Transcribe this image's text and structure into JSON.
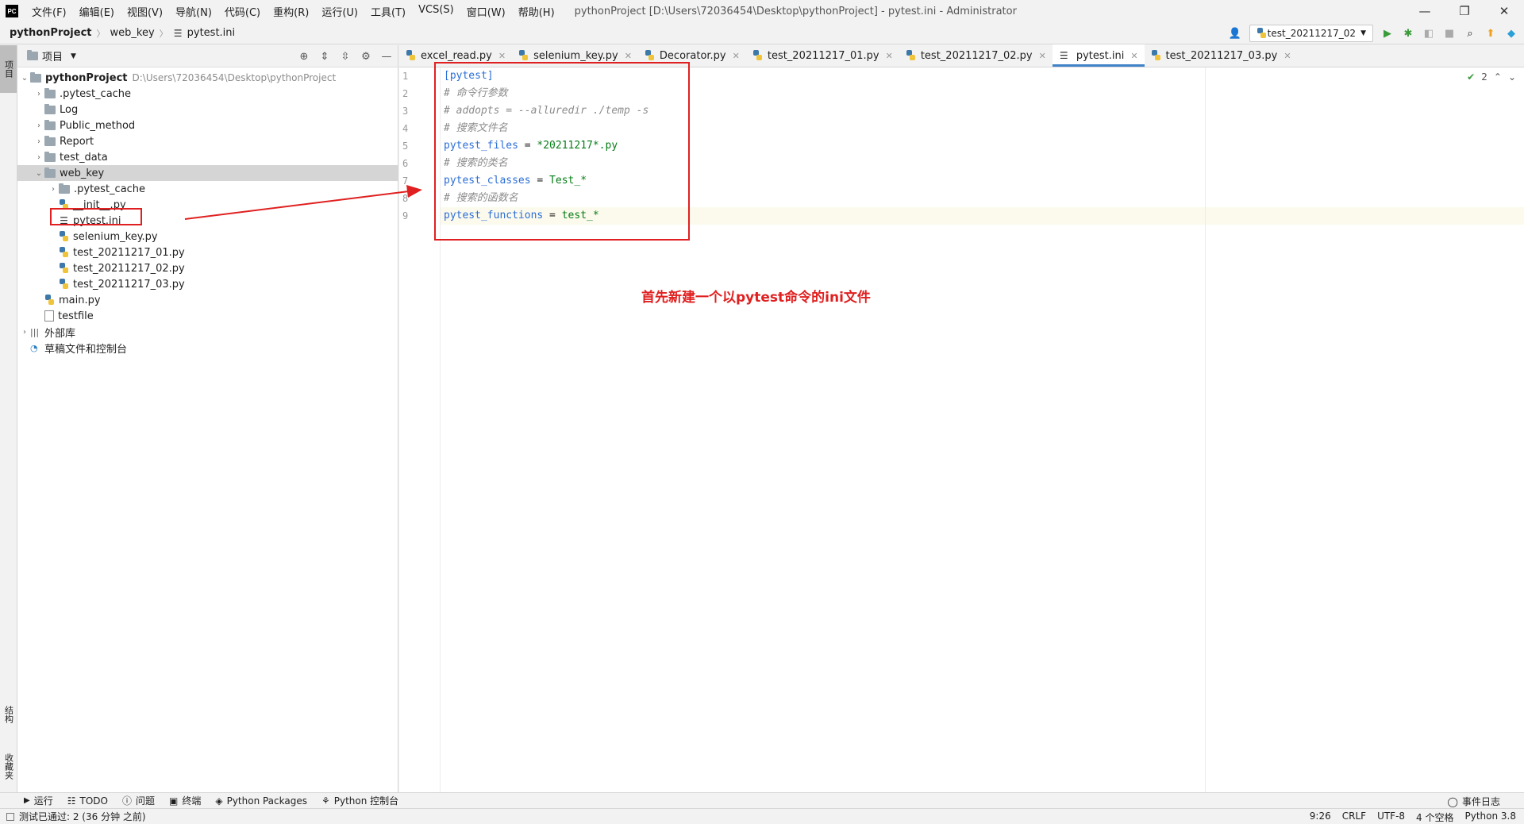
{
  "app": {
    "logo": "PC",
    "title": "pythonProject [D:\\Users\\72036454\\Desktop\\pythonProject] - pytest.ini - Administrator",
    "menu": [
      "文件(F)",
      "编辑(E)",
      "视图(V)",
      "导航(N)",
      "代码(C)",
      "重构(R)",
      "运行(U)",
      "工具(T)",
      "VCS(S)",
      "窗口(W)",
      "帮助(H)"
    ]
  },
  "breadcrumb": {
    "project": "pythonProject",
    "folder": "web_key",
    "file": "pytest.ini"
  },
  "run_config": {
    "name": "test_20211217_02"
  },
  "left_stripe": {
    "project_tab": "项目",
    "structure_tab": "结构",
    "favorites_tab": "收藏夹"
  },
  "project_panel": {
    "title": "项目",
    "tree": [
      {
        "label": "pythonProject",
        "hint": "D:\\Users\\72036454\\Desktop\\pythonProject"
      },
      {
        "label": ".pytest_cache"
      },
      {
        "label": "Log"
      },
      {
        "label": "Public_method"
      },
      {
        "label": "Report"
      },
      {
        "label": "test_data"
      },
      {
        "label": "web_key"
      },
      {
        "label": ".pytest_cache"
      },
      {
        "label": "__init__.py"
      },
      {
        "label": "pytest.ini"
      },
      {
        "label": "selenium_key.py"
      },
      {
        "label": "test_20211217_01.py"
      },
      {
        "label": "test_20211217_02.py"
      },
      {
        "label": "test_20211217_03.py"
      },
      {
        "label": "main.py"
      },
      {
        "label": "testfile"
      },
      {
        "label": "外部库"
      },
      {
        "label": "草稿文件和控制台"
      }
    ]
  },
  "tabs": [
    {
      "label": "excel_read.py"
    },
    {
      "label": "selenium_key.py"
    },
    {
      "label": "Decorator.py"
    },
    {
      "label": "test_20211217_01.py"
    },
    {
      "label": "test_20211217_02.py"
    },
    {
      "label": "pytest.ini"
    },
    {
      "label": "test_20211217_03.py"
    }
  ],
  "editor": {
    "line_numbers": [
      "1",
      "2",
      "3",
      "4",
      "5",
      "6",
      "7",
      "8",
      "9"
    ],
    "lines": {
      "l1": "[pytest]",
      "l2": "# 命令行参数",
      "l3": "# addopts = --alluredir ./temp -s",
      "l4": "# 搜索文件名",
      "l5_key": "pytest_files",
      "l5_val": "*20211217*.py",
      "l6": "# 搜索的类名",
      "l7_key": "pytest_classes",
      "l7_val": "Test_*",
      "l8": "# 搜索的函数名",
      "l9_key": "pytest_functions",
      "l9_val": "test_*",
      "eq": " = "
    },
    "inspection_count": "2"
  },
  "annotation": "首先新建一个以pytest命令的ini文件",
  "bottom_tools": {
    "run": "运行",
    "todo": "TODO",
    "problems": "问题",
    "terminal": "终端",
    "packages": "Python Packages",
    "console": "Python 控制台",
    "event_log": "事件日志"
  },
  "status": {
    "message": "测试已通过: 2 (36 分钟 之前)",
    "position": "9:26",
    "line_sep": "CRLF",
    "encoding": "UTF-8",
    "indent": "4 个空格",
    "interpreter": "Python 3.8"
  },
  "colors": {
    "accent": "#4083c9",
    "annotation": "#e02020",
    "keyword": "#2b6ed6",
    "value": "#067d17",
    "comment": "#8c8c8c"
  }
}
